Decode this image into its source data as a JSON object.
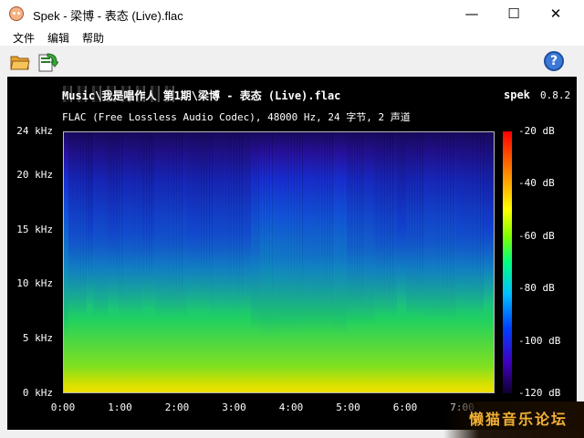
{
  "window": {
    "title": "Spek - 梁博 - 表态 (Live).flac",
    "controls": {
      "minimize": "—",
      "maximize": "☐",
      "close": "✕"
    }
  },
  "menu": {
    "items": [
      "文件",
      "编辑",
      "帮助"
    ]
  },
  "toolbar": {
    "icons": [
      "open-folder-icon",
      "save-export-icon",
      "help-icon"
    ],
    "help_glyph": "?"
  },
  "spectrogram": {
    "title": "Music\\我是唱作人 第1期\\梁博 - 表态 (Live).flac",
    "app_name": "spek",
    "app_version": "0.8.2",
    "info": "FLAC (Free Lossless Audio Codec), 48000 Hz, 24 字节, 2 声道",
    "freq_ticks": [
      "24 kHz",
      "20 kHz",
      "15 kHz",
      "10 kHz",
      "5 kHz",
      "0 kHz"
    ],
    "time_ticks": [
      "0:00",
      "1:00",
      "2:00",
      "3:00",
      "4:00",
      "5:00",
      "6:00",
      "7:00"
    ],
    "db_ticks": [
      "-20 dB",
      "-40 dB",
      "-60 dB",
      "-80 dB",
      "-100 dB",
      "-120 dB"
    ]
  },
  "watermark": "懒猫音乐论坛"
}
